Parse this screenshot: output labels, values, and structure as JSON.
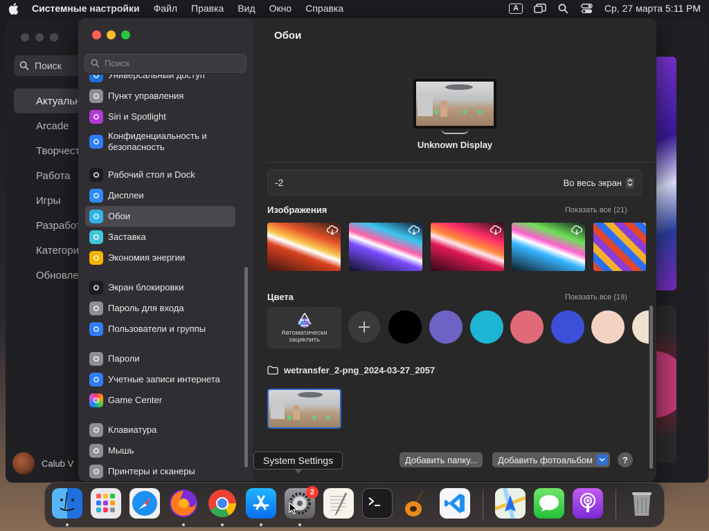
{
  "menubar": {
    "app_name": "Системные настройки",
    "menus": [
      "Файл",
      "Правка",
      "Вид",
      "Окно",
      "Справка"
    ],
    "input_badge": "A",
    "datetime": "Ср, 27 марта  5:11 PM"
  },
  "bg_app": {
    "search_label": "Поиск",
    "nav": [
      "Актуальное",
      "Arcade",
      "Творчество",
      "Работа",
      "Игры",
      "Разработка",
      "Категории",
      "Обновления"
    ],
    "user_name": "Calub V"
  },
  "settings": {
    "search_placeholder": "Поиск",
    "sidebar": [
      {
        "label": "Универсальный доступ",
        "icon": "accessibility-icon",
        "color": "#1f6fe0"
      },
      {
        "label": "Пункт управления",
        "icon": "control-center-icon",
        "color": "#8e8e93"
      },
      {
        "label": "Siri и Spotlight",
        "icon": "siri-icon",
        "color": "#b03ad6"
      },
      {
        "label": "Конфиденциальность и безопасность",
        "icon": "privacy-hand-icon",
        "color": "#2f7cf6"
      },
      {
        "label": "Рабочий стол и Dock",
        "icon": "desktop-dock-icon",
        "color": "#1c1c1e"
      },
      {
        "label": "Дисплеи",
        "icon": "displays-icon",
        "color": "#2f8cf6"
      },
      {
        "label": "Обои",
        "icon": "wallpaper-icon",
        "color": "#2fb4e8"
      },
      {
        "label": "Заставка",
        "icon": "screensaver-icon",
        "color": "#3fc6d8"
      },
      {
        "label": "Экономия энергии",
        "icon": "energy-icon",
        "color": "#f5b400"
      },
      {
        "label": "Экран блокировки",
        "icon": "lock-screen-icon",
        "color": "#1c1c1e"
      },
      {
        "label": "Пароль для входа",
        "icon": "login-password-icon",
        "color": "#8e8e93"
      },
      {
        "label": "Пользователи и группы",
        "icon": "users-groups-icon",
        "color": "#2f7cf6"
      },
      {
        "label": "Пароли",
        "icon": "key-icon",
        "color": "#8e8e93"
      },
      {
        "label": "Учетные записи интернета",
        "icon": "internet-accounts-icon",
        "color": "#2f7cf6"
      },
      {
        "label": "Game Center",
        "icon": "game-center-icon",
        "color": "#ffffff"
      },
      {
        "label": "Клавиатура",
        "icon": "keyboard-icon",
        "color": "#8e8e93"
      },
      {
        "label": "Мышь",
        "icon": "mouse-icon",
        "color": "#8e8e93"
      },
      {
        "label": "Принтеры и сканеры",
        "icon": "printer-icon",
        "color": "#8e8e93"
      }
    ],
    "active_item": "Обои",
    "content": {
      "title": "Обои",
      "display_name": "Unknown Display",
      "wallpaper_name": "-2",
      "fill_mode": "Во весь экран",
      "images_title": "Изображения",
      "images_show_all": "Показать все (21)",
      "colors_title": "Цвета",
      "colors_show_all": "Показать все (19)",
      "auto_cycle_label": "Автоматически зациклить",
      "swatches": [
        "#000000",
        "#6e62c4",
        "#1eb4d4",
        "#e06a78",
        "#3c4fd8",
        "#f5d3c4",
        "#efe0cf"
      ],
      "folder_name": "wetransfer_2-png_2024-03-27_2057",
      "add_folder_button": "Добавить папку...",
      "add_album_button": "Добавить фотоальбом",
      "help_button": "?"
    }
  },
  "tooltip": "System Settings",
  "dock": {
    "apps": [
      {
        "name": "Finder",
        "icon": "finder-icon",
        "running": true
      },
      {
        "name": "Launchpad",
        "icon": "launchpad-icon",
        "running": false
      },
      {
        "name": "Safari",
        "icon": "safari-icon",
        "running": false
      },
      {
        "name": "Firefox",
        "icon": "firefox-icon",
        "running": true
      },
      {
        "name": "Chrome",
        "icon": "chrome-icon",
        "running": true
      },
      {
        "name": "App Store",
        "icon": "app-store-icon",
        "running": true
      },
      {
        "name": "System Settings",
        "icon": "system-settings-icon",
        "running": true,
        "badge": "2"
      },
      {
        "name": "TextEdit",
        "icon": "textedit-icon",
        "running": false
      },
      {
        "name": "Terminal",
        "icon": "terminal-icon",
        "running": false
      },
      {
        "name": "GarageBand",
        "icon": "garageband-icon",
        "running": false
      },
      {
        "name": "VS Code",
        "icon": "vscode-icon",
        "running": false
      },
      {
        "name": "Maps",
        "icon": "maps-icon",
        "running": false
      },
      {
        "name": "Messages",
        "icon": "messages-icon",
        "running": false
      },
      {
        "name": "Podcasts",
        "icon": "podcasts-icon",
        "running": false
      },
      {
        "name": "Trash",
        "icon": "trash-icon",
        "running": false
      }
    ]
  }
}
